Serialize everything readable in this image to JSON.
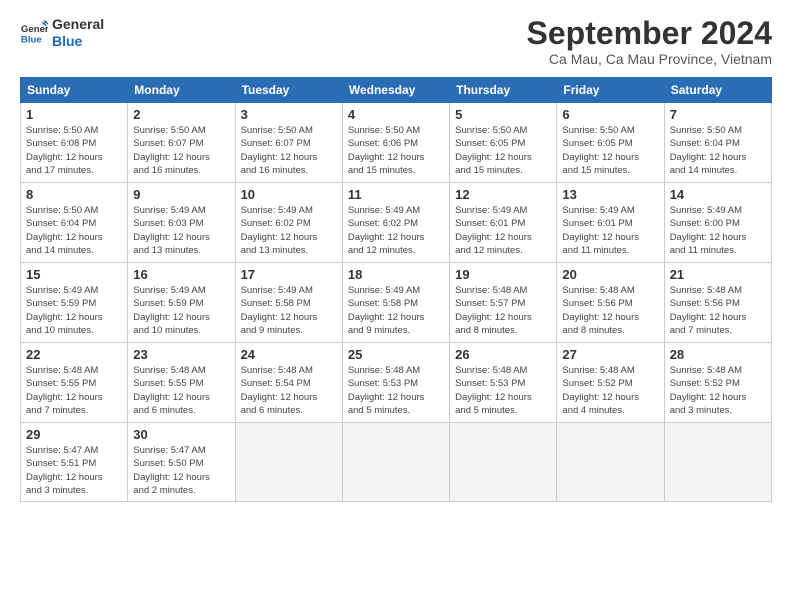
{
  "logo": {
    "line1": "General",
    "line2": "Blue"
  },
  "title": "September 2024",
  "subtitle": "Ca Mau, Ca Mau Province, Vietnam",
  "weekdays": [
    "Sunday",
    "Monday",
    "Tuesday",
    "Wednesday",
    "Thursday",
    "Friday",
    "Saturday"
  ],
  "weeks": [
    [
      {
        "day": "1",
        "info": "Sunrise: 5:50 AM\nSunset: 6:08 PM\nDaylight: 12 hours\nand 17 minutes."
      },
      {
        "day": "2",
        "info": "Sunrise: 5:50 AM\nSunset: 6:07 PM\nDaylight: 12 hours\nand 16 minutes."
      },
      {
        "day": "3",
        "info": "Sunrise: 5:50 AM\nSunset: 6:07 PM\nDaylight: 12 hours\nand 16 minutes."
      },
      {
        "day": "4",
        "info": "Sunrise: 5:50 AM\nSunset: 6:06 PM\nDaylight: 12 hours\nand 15 minutes."
      },
      {
        "day": "5",
        "info": "Sunrise: 5:50 AM\nSunset: 6:05 PM\nDaylight: 12 hours\nand 15 minutes."
      },
      {
        "day": "6",
        "info": "Sunrise: 5:50 AM\nSunset: 6:05 PM\nDaylight: 12 hours\nand 15 minutes."
      },
      {
        "day": "7",
        "info": "Sunrise: 5:50 AM\nSunset: 6:04 PM\nDaylight: 12 hours\nand 14 minutes."
      }
    ],
    [
      {
        "day": "8",
        "info": "Sunrise: 5:50 AM\nSunset: 6:04 PM\nDaylight: 12 hours\nand 14 minutes."
      },
      {
        "day": "9",
        "info": "Sunrise: 5:49 AM\nSunset: 6:03 PM\nDaylight: 12 hours\nand 13 minutes."
      },
      {
        "day": "10",
        "info": "Sunrise: 5:49 AM\nSunset: 6:02 PM\nDaylight: 12 hours\nand 13 minutes."
      },
      {
        "day": "11",
        "info": "Sunrise: 5:49 AM\nSunset: 6:02 PM\nDaylight: 12 hours\nand 12 minutes."
      },
      {
        "day": "12",
        "info": "Sunrise: 5:49 AM\nSunset: 6:01 PM\nDaylight: 12 hours\nand 12 minutes."
      },
      {
        "day": "13",
        "info": "Sunrise: 5:49 AM\nSunset: 6:01 PM\nDaylight: 12 hours\nand 11 minutes."
      },
      {
        "day": "14",
        "info": "Sunrise: 5:49 AM\nSunset: 6:00 PM\nDaylight: 12 hours\nand 11 minutes."
      }
    ],
    [
      {
        "day": "15",
        "info": "Sunrise: 5:49 AM\nSunset: 5:59 PM\nDaylight: 12 hours\nand 10 minutes."
      },
      {
        "day": "16",
        "info": "Sunrise: 5:49 AM\nSunset: 5:59 PM\nDaylight: 12 hours\nand 10 minutes."
      },
      {
        "day": "17",
        "info": "Sunrise: 5:49 AM\nSunset: 5:58 PM\nDaylight: 12 hours\nand 9 minutes."
      },
      {
        "day": "18",
        "info": "Sunrise: 5:49 AM\nSunset: 5:58 PM\nDaylight: 12 hours\nand 9 minutes."
      },
      {
        "day": "19",
        "info": "Sunrise: 5:48 AM\nSunset: 5:57 PM\nDaylight: 12 hours\nand 8 minutes."
      },
      {
        "day": "20",
        "info": "Sunrise: 5:48 AM\nSunset: 5:56 PM\nDaylight: 12 hours\nand 8 minutes."
      },
      {
        "day": "21",
        "info": "Sunrise: 5:48 AM\nSunset: 5:56 PM\nDaylight: 12 hours\nand 7 minutes."
      }
    ],
    [
      {
        "day": "22",
        "info": "Sunrise: 5:48 AM\nSunset: 5:55 PM\nDaylight: 12 hours\nand 7 minutes."
      },
      {
        "day": "23",
        "info": "Sunrise: 5:48 AM\nSunset: 5:55 PM\nDaylight: 12 hours\nand 6 minutes."
      },
      {
        "day": "24",
        "info": "Sunrise: 5:48 AM\nSunset: 5:54 PM\nDaylight: 12 hours\nand 6 minutes."
      },
      {
        "day": "25",
        "info": "Sunrise: 5:48 AM\nSunset: 5:53 PM\nDaylight: 12 hours\nand 5 minutes."
      },
      {
        "day": "26",
        "info": "Sunrise: 5:48 AM\nSunset: 5:53 PM\nDaylight: 12 hours\nand 5 minutes."
      },
      {
        "day": "27",
        "info": "Sunrise: 5:48 AM\nSunset: 5:52 PM\nDaylight: 12 hours\nand 4 minutes."
      },
      {
        "day": "28",
        "info": "Sunrise: 5:48 AM\nSunset: 5:52 PM\nDaylight: 12 hours\nand 3 minutes."
      }
    ],
    [
      {
        "day": "29",
        "info": "Sunrise: 5:47 AM\nSunset: 5:51 PM\nDaylight: 12 hours\nand 3 minutes."
      },
      {
        "day": "30",
        "info": "Sunrise: 5:47 AM\nSunset: 5:50 PM\nDaylight: 12 hours\nand 2 minutes."
      },
      {
        "day": "",
        "info": ""
      },
      {
        "day": "",
        "info": ""
      },
      {
        "day": "",
        "info": ""
      },
      {
        "day": "",
        "info": ""
      },
      {
        "day": "",
        "info": ""
      }
    ]
  ]
}
